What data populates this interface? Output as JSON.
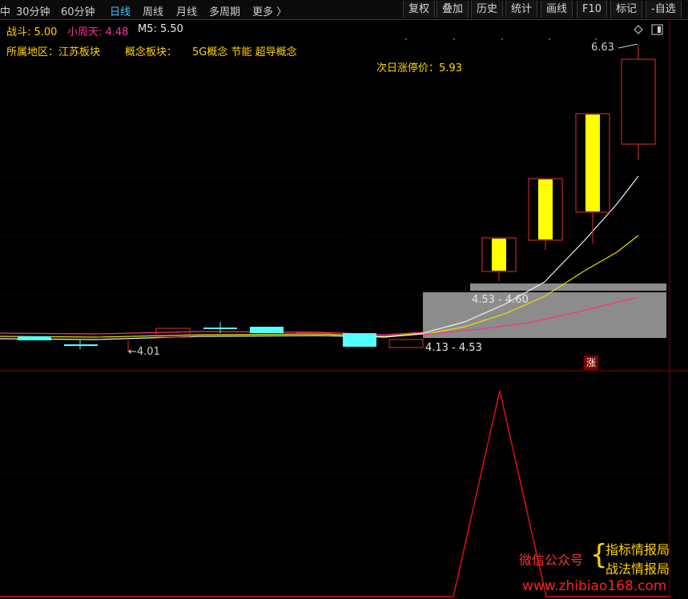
{
  "toolbar": {
    "periods": [
      "中",
      "30分钟",
      "60分钟",
      "日线",
      "周线",
      "月线",
      "多周期",
      "更多 〉"
    ],
    "active_period": "日线",
    "buttons": [
      "复权",
      "叠加",
      "历史",
      "统计",
      "画线",
      "F10",
      "标记",
      "-自选"
    ]
  },
  "indicators": {
    "zhandou_label": "战斗: 5.00",
    "xiaozhoutian_label": "小周天: 4.48",
    "m5_label": "M5: 5.50"
  },
  "sector_line": {
    "region_label": "所属地区：江苏板块",
    "concept_label": "概念板块：",
    "concepts": "5G概念 节能 超导概念"
  },
  "limit_up_label": "次日涨停价：5.93",
  "annotations": {
    "high": "6.63",
    "low": "←4.01",
    "zone_upper": "4.53 - 4.60",
    "zone_lower": "4.13 - 4.53",
    "zhang_badge": "涨"
  },
  "watermark": {
    "prefix": "微信公众号",
    "brace": "{",
    "line1": "指标情报局",
    "line2": "战法情报局",
    "url": "www.zhibiao168.com"
  },
  "colors": {
    "up_candle": "#ffff00",
    "down_candle": "#54ffff",
    "border_red": "#e03030",
    "ma_white": "#f0f0f0",
    "ma_yellow": "#e8e000",
    "ma_magenta": "#ff2d8a",
    "signal_line": "#e01010"
  }
}
